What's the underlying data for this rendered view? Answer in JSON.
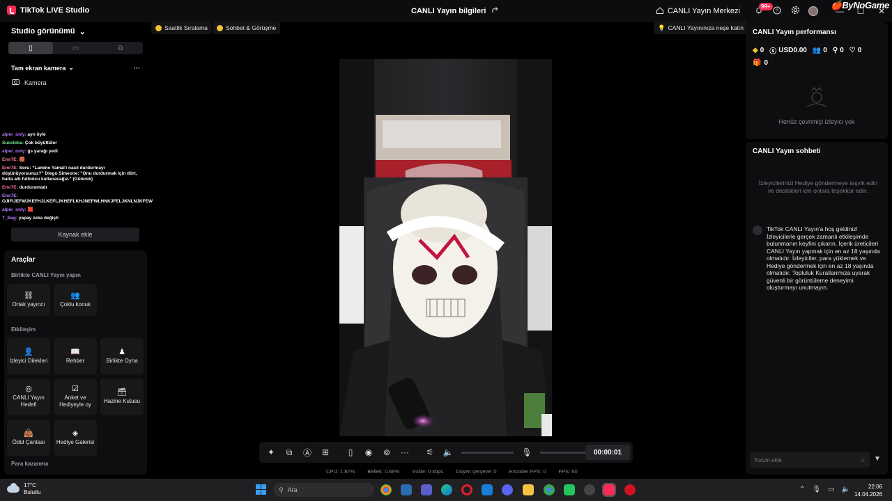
{
  "titlebar": {
    "app_name": "TikTok LIVE Studio",
    "center_title": "CANLI Yayın bilgileri",
    "live_center": "CANLI Yayın Merkezi",
    "notif_badge": "99+",
    "watermark": "ByNoGame"
  },
  "left": {
    "studio_view": "Studio görünümü",
    "scene_name": "Tam ekran kamera",
    "source_camera": "Kamera",
    "add_source": "Kaynak ekle",
    "chat_overlay": [
      {
        "user": "alper_only:",
        "msg": "ayn öyle",
        "color": "purple"
      },
      {
        "user": "Suesteba:",
        "msg": "Çok büyüttüler",
        "color": "green"
      },
      {
        "user": "alper_only:",
        "msg": "gs yarağı yedi",
        "color": "purple"
      },
      {
        "user": "Emr7E:",
        "msg": "🧱",
        "color": "red"
      },
      {
        "user": "Emr7E:",
        "msg": "Soru: “Lamine Yamal'ı nasıl durdurmayı düşünüyorsunuz?” Diego Simeone: “Onu durdurmak için dört, hatta altı futbolcu kullanacağız.” (Gülerek)",
        "color": "red"
      },
      {
        "user": "Emr7E:",
        "msg": "durduramadı",
        "color": "red"
      },
      {
        "user": "",
        "msg": "",
        "color": "red"
      },
      {
        "user": "Emr7E:",
        "msg": "OJIFIJEFWJKEFHJLKEFLJKHEFLKHJNEFWLHNKJFELJKNLNJKFEW",
        "color": "purple"
      },
      {
        "user": "alper_only:",
        "msg": "🟥",
        "color": "purple"
      },
      {
        "user": "T_Bag:",
        "msg": "yapay zeka değişti",
        "color": "purple"
      }
    ],
    "tools": {
      "title": "Araçlar",
      "sec_together": "Birlikte CANLI Yayın yapın",
      "sec_interaction": "Etkileşim",
      "sec_earn": "Para kazanma",
      "co_host": "Ortak yayıncı",
      "multi_guest": "Çoklu konuk",
      "viewer_requests": "İzleyici Dilekleri",
      "guide": "Rehber",
      "play_together": "Birlikte Oyna",
      "live_goal": "CANLI Yayın Hedefi",
      "poll": "Anket ve Hediyeyle oy",
      "treasure_box": "Hazine Kutusu",
      "reward_bag": "Ödül Çantası",
      "gift_gallery": "Hediye Galerisi"
    }
  },
  "main": {
    "hourly_rank": "Saatlik Sıralama",
    "chat_match": "Sohbet & Görüşme",
    "fun_live": "CANLI Yayınınıza neşe katın",
    "timer": "00:00:01",
    "stats": {
      "cpu": "CPU: 1.87%",
      "memory": "Bellek: 0.68%",
      "upload": "Yükle: 0 kbps",
      "dropped": "Düşen çerçeve: 0",
      "encoder_fps": "Encoder FPS: 0",
      "fps": "FPS: 60"
    }
  },
  "right": {
    "perf_title": "CANLI Yayın performansı",
    "coins": "0",
    "usd": "USD0.00",
    "viewers": "0",
    "followers": "0",
    "likes": "0",
    "gifts": "0",
    "no_viewers": "Henüz çevrimiçi izleyici yok",
    "chat_title": "CANLI Yayın sohbeti",
    "chat_tip": "İzleyicilerinizi Hediye göndermeye teşvik edin ve destekleri için onlara teşekkür edin.",
    "welcome": "TikTok CANLI Yayın'a hoş geldiniz! İzleyicilerle gerçek zamanlı etkileşimde bulunmanın keyfini çıkarın. İçerik üreticileri CANLI Yayın yapmak için en az 18 yaşında olmalıdır. İzleyiciler, para yüklemek ve Hediye göndermek için en az 18 yaşında olmalıdır. Topluluk Kurallarımıza uyarak güvenli bir görüntüleme deneyimi oluşturmayı unutmayın.",
    "comment_placeholder": "Yorum ekle"
  },
  "taskbar": {
    "temp": "17°C",
    "weather": "Bulutlu",
    "search": "Ara",
    "time": "22:06",
    "date": "14.04.2026"
  },
  "colors": {
    "accent": "#ff2a55",
    "panel": "#0e0e10",
    "background": "#000000"
  }
}
